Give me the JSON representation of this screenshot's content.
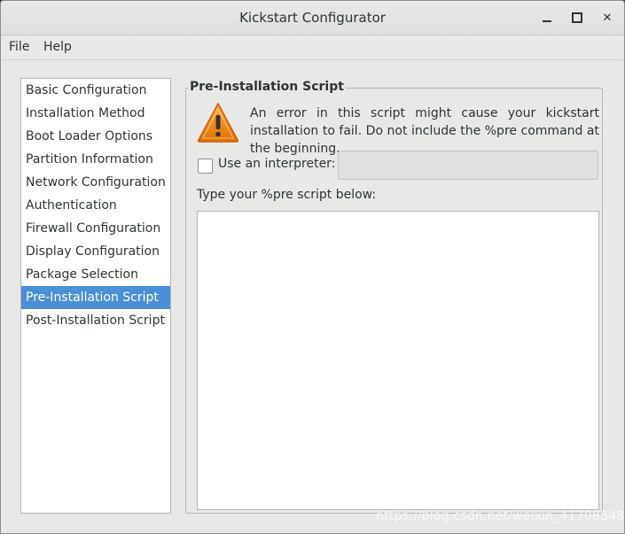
{
  "window": {
    "title": "Kickstart Configurator",
    "minimize_glyph": "—",
    "maximize_glyph": "□",
    "close_glyph": "✕"
  },
  "menu": [
    "File",
    "Help"
  ],
  "sidebar": {
    "items": [
      {
        "label": "Basic Configuration"
      },
      {
        "label": "Installation Method"
      },
      {
        "label": "Boot Loader Options"
      },
      {
        "label": "Partition Information"
      },
      {
        "label": "Network Configuration"
      },
      {
        "label": "Authentication"
      },
      {
        "label": "Firewall Configuration"
      },
      {
        "label": "Display Configuration"
      },
      {
        "label": "Package Selection"
      },
      {
        "label": "Pre-Installation Script"
      },
      {
        "label": "Post-Installation Script"
      }
    ],
    "selected": "Pre-Installation Script"
  },
  "panel": {
    "title": "Pre-Installation Script",
    "warning_text": "An error in this script might cause your kickstart installation to fail. Do not include the %pre command at the beginning.",
    "interpreter_label": "Use an interpreter:",
    "interpreter_checked": false,
    "interpreter_value": "",
    "script_label": "Type your %pre script below:",
    "script_value": ""
  },
  "watermark": "https://blog.csdn.net/weixin_41708548",
  "colors": {
    "selection": "#4a90d9",
    "warning": "#f57900"
  }
}
